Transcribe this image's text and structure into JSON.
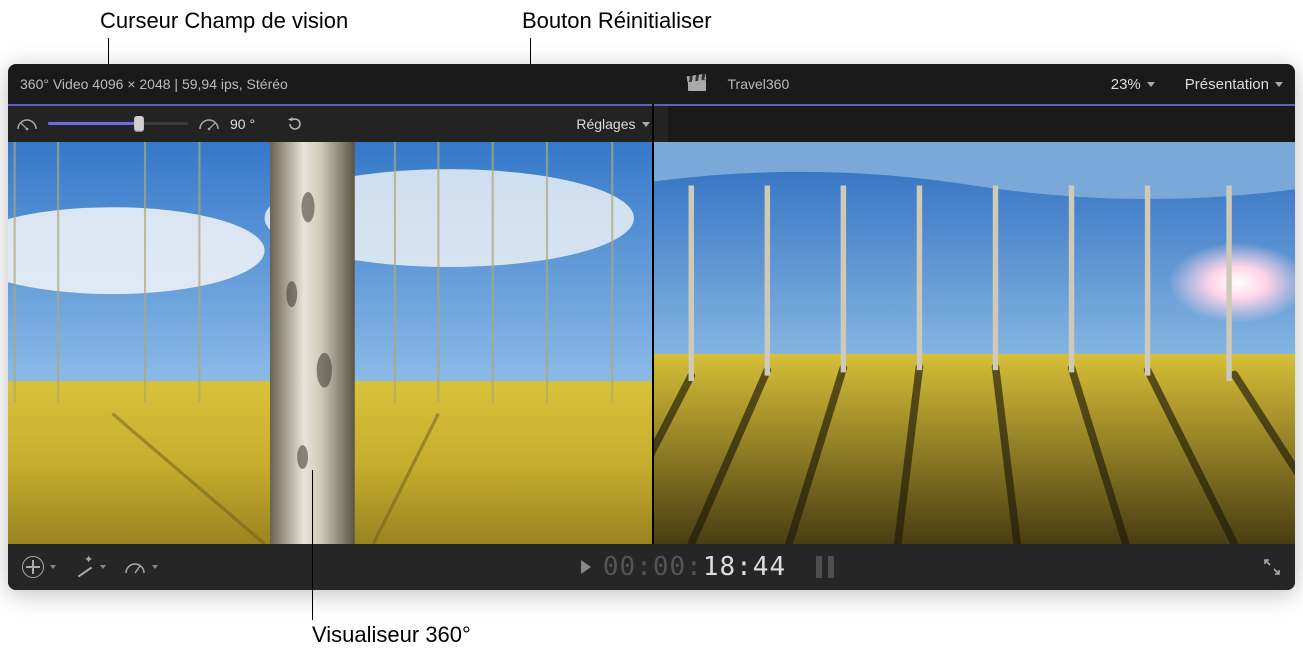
{
  "callouts": {
    "fov_slider": "Curseur Champ de vision",
    "reset_button": "Bouton Réinitialiser",
    "viewer360": "Visualiseur 360°"
  },
  "header_left": {
    "info": "360° Video 4096 × 2048 | 59,94 ips, Stéréo"
  },
  "header_right": {
    "project_name": "Travel360",
    "zoom_label": "23%",
    "presentation_label": "Présentation"
  },
  "toolbar": {
    "fov_value_label": "90 °",
    "fov_percent": 65,
    "settings_label": "Réglages"
  },
  "footer": {
    "timecode_dim": "00:00:",
    "timecode_lit": "18:44"
  },
  "colors": {
    "accent": "#5b5fc7",
    "panel": "#1a1a1a"
  }
}
